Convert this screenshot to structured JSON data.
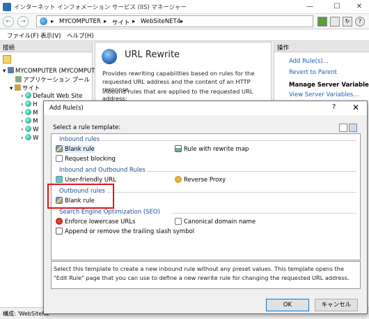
{
  "window": {
    "title": "インターネット インフォメーション サービス (IIS) マネージャー",
    "controls": [
      "—",
      "☐",
      "✕"
    ]
  },
  "address": {
    "crumbs": [
      "MYCOMPUTER",
      "サイト",
      "WebSiteNET4"
    ],
    "sep": "▸"
  },
  "menu": [
    "ファイル(F)",
    "表示(V)",
    "ヘルプ(H)"
  ],
  "connections": {
    "header": "接続",
    "tree": [
      {
        "label": "MYCOMPUTER (MYCOMPUTE"
      },
      {
        "label": "アプリケーション プール"
      },
      {
        "label": "サイト"
      },
      {
        "label": "Default Web Site"
      },
      {
        "label": "H"
      },
      {
        "label": "M"
      },
      {
        "label": "M"
      },
      {
        "label": "W"
      },
      {
        "label": "W"
      }
    ]
  },
  "center": {
    "title": "URL Rewrite",
    "description": "Provides rewriting capabilities based on rules for the requested URL address and the content of an HTTP response.",
    "inbound_text": "Inbound rules that are applied to the requested URL address:"
  },
  "actions": {
    "header": "操作",
    "items": [
      {
        "label": "Add Rule(s)...",
        "bold": false
      },
      {
        "label": "Revert to Parent",
        "bold": false
      },
      {
        "label": "Manage Server Variables",
        "bold": true
      },
      {
        "label": "View Server Variables...",
        "bold": false
      }
    ]
  },
  "status": {
    "text": "構成: 'WebSiteNE"
  },
  "dialog": {
    "title": "Add Rule(s)",
    "help": "?",
    "close": "✕",
    "select_label": "Select a rule template:",
    "groups": {
      "inbound": "Inbound rules",
      "inout": "Inbound and Outbound Rules",
      "outbound": "Outbound rules",
      "seo": "Search Engine Optimization (SEO)"
    },
    "items": {
      "blank_rule_in": "Blank rule",
      "request_blocking": "Request blocking",
      "rewrite_map": "Rule with rewrite map",
      "user_friendly": "User-friendly URL",
      "reverse_proxy": "Reverse Proxy",
      "blank_rule_out": "Blank rule",
      "lowercase": "Enforce lowercase URLs",
      "canonical": "Canonical domain name",
      "trailing_slash": "Append or remove the trailing slash symbol"
    },
    "description": "Select this template to create a new inbound rule without any preset values. This template opens the \"Edit Rule\" page that you can use to define a new rewrite rule for changing the requested URL address.",
    "ok": "OK",
    "cancel": "キャンセル"
  }
}
